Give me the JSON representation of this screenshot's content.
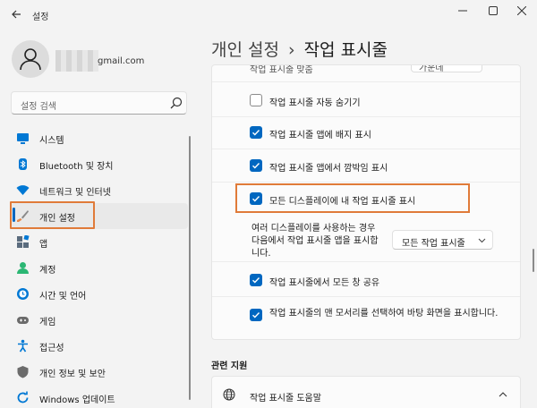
{
  "window": {
    "title": "설정",
    "back_icon": "back-arrow-icon",
    "minimize_icon": "minimize-icon",
    "maximize_icon": "maximize-icon",
    "close_icon": "close-icon"
  },
  "account": {
    "email_suffix": "gmail.com"
  },
  "search": {
    "placeholder": "설정 검색",
    "icon": "search-icon"
  },
  "nav": [
    {
      "label": "시스템",
      "icon": "system-icon",
      "color": "#0078d4"
    },
    {
      "label": "Bluetooth 및 장치",
      "icon": "bluetooth-icon",
      "color": "#0078d4"
    },
    {
      "label": "네트워크 및 인터넷",
      "icon": "wifi-icon",
      "color": "#0078d4"
    },
    {
      "label": "개인 설정",
      "icon": "brush-icon",
      "color": "#e5874a",
      "selected": true
    },
    {
      "label": "앱",
      "icon": "apps-icon",
      "color": "#5a6b7d"
    },
    {
      "label": "계정",
      "icon": "account-icon",
      "color": "#2bb673"
    },
    {
      "label": "시간 및 언어",
      "icon": "time-language-icon",
      "color": "#0078d4"
    },
    {
      "label": "게임",
      "icon": "gaming-icon",
      "color": "#6b6b6b"
    },
    {
      "label": "접근성",
      "icon": "accessibility-icon",
      "color": "#0078d4"
    },
    {
      "label": "개인 정보 및 보안",
      "icon": "shield-icon",
      "color": "#6b6b6b"
    },
    {
      "label": "Windows 업데이트",
      "icon": "update-icon",
      "color": "#0078d4"
    }
  ],
  "header": {
    "breadcrumb_parent": "개인 설정",
    "separator": "›",
    "page_title": "작업 표시줄"
  },
  "taskbar_behaviors": {
    "cut_off_label": "작업 표시줄 맞춤",
    "cut_off_value": "가운데",
    "options": [
      {
        "label": "작업 표시줄 자동 숨기기",
        "checked": false
      },
      {
        "label": "작업 표시줄 앱에 배지 표시",
        "checked": true
      },
      {
        "label": "작업 표시줄 앱에서 깜박임 표시",
        "checked": true
      },
      {
        "label": "모든 디스플레이에 내 작업 표시줄 표시",
        "checked": true,
        "highlighted": true
      }
    ],
    "multi_display_label": "여러 디스플레이를 사용하는 경우 다음에서 작업 표시줄 앱을 표시합니다.",
    "multi_display_value": "모든 작업 표시줄",
    "share_option": {
      "label": "작업 표시줄에서 모든 창 공유",
      "checked": true
    },
    "corner_option": {
      "label": "작업 표시줄의 맨 모서리를 선택하여 바탕 화면을 표시합니다.",
      "checked": true
    }
  },
  "related": {
    "section_title": "관련 지원",
    "help_label": "작업 표시줄 도움말",
    "help_icon": "globe-icon",
    "chevron_icon": "chevron-up-icon"
  },
  "colors": {
    "accent": "#0067c0",
    "highlight_outline": "#e07b39"
  }
}
